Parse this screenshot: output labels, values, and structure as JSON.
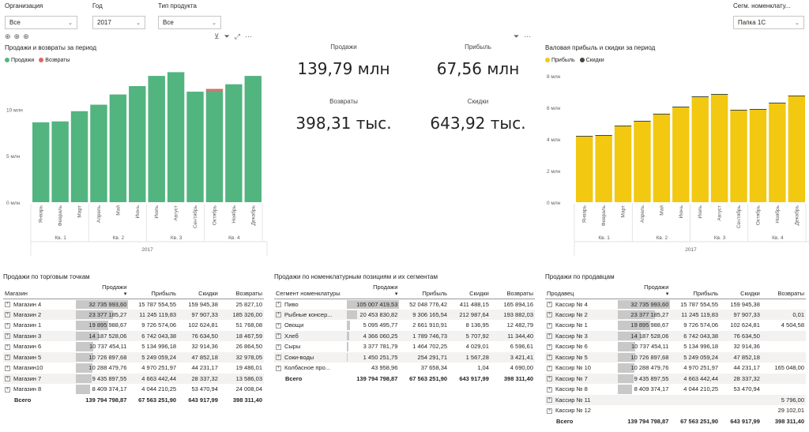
{
  "slicers": {
    "org": {
      "label": "Организация",
      "value": "Все"
    },
    "year": {
      "label": "Год",
      "value": "2017"
    },
    "ptype": {
      "label": "Тип продукта",
      "value": "Все"
    },
    "segm": {
      "label": "Сегм. номенклату...",
      "value": "Папка 1С"
    }
  },
  "icons": {
    "drill_up": "arrow-up-circle",
    "drill_down": "arrow-down-circle",
    "expand": "fork",
    "filter": "funnel",
    "focus": "expand-box",
    "more": "ellipsis"
  },
  "colors": {
    "sales": "#52b47f",
    "returns": "#e06666",
    "profit": "#f2c811",
    "discounts": "#3d4a3d"
  },
  "left_chart": {
    "title": "Продажи и возвраты за период",
    "legend": [
      "Продажи",
      "Возвраты"
    ],
    "chart_data": {
      "type": "bar",
      "categories": [
        "Январь",
        "Февраль",
        "Март",
        "Апрель",
        "Май",
        "Июнь",
        "Июль",
        "Август",
        "Сентябрь",
        "Октябрь",
        "Ноябрь",
        "Декабрь"
      ],
      "quarters": [
        "Кв. 1",
        "Кв. 2",
        "Кв. 3",
        "Кв. 4"
      ],
      "year": "2017",
      "series": [
        {
          "name": "Продажи",
          "values": [
            8.6,
            8.7,
            9.8,
            10.5,
            11.6,
            12.5,
            13.6,
            14.0,
            11.9,
            12.0,
            12.7,
            13.6
          ]
        },
        {
          "name": "Возвраты",
          "values": [
            0,
            0,
            0,
            0,
            0,
            0,
            0,
            0,
            0,
            0.2,
            0,
            0
          ]
        }
      ],
      "yticks": [
        "0 млн",
        "5 млн",
        "10 млн"
      ],
      "ylim": [
        0,
        14.8
      ]
    }
  },
  "kpis": [
    {
      "label": "Продажи",
      "value": "139,79 млн"
    },
    {
      "label": "Прибыль",
      "value": "67,56 млн"
    },
    {
      "label": "Возвраты",
      "value": "398,31 тыс."
    },
    {
      "label": "Скидки",
      "value": "643,92 тыс."
    }
  ],
  "right_chart": {
    "title": "Валовая прибыль и скидки за период",
    "legend": [
      "Прибыль",
      "Скидки"
    ],
    "chart_data": {
      "type": "bar",
      "categories": [
        "Январь",
        "Февраль",
        "Март",
        "Апрель",
        "Май",
        "Июнь",
        "Июль",
        "Август",
        "Сентябрь",
        "Октябрь",
        "Ноябрь",
        "Декабрь"
      ],
      "quarters": [
        "Кв. 1",
        "Кв. 2",
        "Кв. 3",
        "Кв. 4"
      ],
      "year": "2017",
      "series": [
        {
          "name": "Прибыль",
          "values": [
            4.15,
            4.2,
            4.8,
            5.1,
            5.55,
            6.0,
            6.65,
            6.8,
            5.8,
            5.85,
            6.25,
            6.7
          ]
        },
        {
          "name": "Скидки",
          "values": [
            0.05,
            0.05,
            0.05,
            0.05,
            0.05,
            0.05,
            0.05,
            0.05,
            0.05,
            0.05,
            0.05,
            0.05
          ]
        }
      ],
      "yticks": [
        "0 млн",
        "2 млн",
        "4 млн",
        "6 млн",
        "8 млн"
      ],
      "ylim": [
        0,
        8.4
      ]
    }
  },
  "table1": {
    "title": "Продажи по торговым точкам",
    "headers": [
      "Магазин",
      "Продажи",
      "Прибыль",
      "Скидки",
      "Возвраты"
    ],
    "rows": [
      {
        "name": "Магазин 4",
        "sales": "32 735 993,60",
        "profit": "15 787 554,55",
        "disc": "159 945,38",
        "ret": "25 827,10",
        "pct": 1.0
      },
      {
        "name": "Магазин 2",
        "sales": "23 377 185,27",
        "profit": "11 245 119,83",
        "disc": "97 907,33",
        "ret": "185 326,00",
        "pct": 0.71
      },
      {
        "name": "Магазин 1",
        "sales": "19 895 988,67",
        "profit": "9 726 574,06",
        "disc": "102 624,81",
        "ret": "51 768,08",
        "pct": 0.61
      },
      {
        "name": "Магазин 3",
        "sales": "14 187 528,06",
        "profit": "6 742 043,38",
        "disc": "76 634,50",
        "ret": "18 467,59",
        "pct": 0.43
      },
      {
        "name": "Магазин 6",
        "sales": "10 737 454,11",
        "profit": "5 134 996,18",
        "disc": "32 914,36",
        "ret": "26 864,50",
        "pct": 0.33
      },
      {
        "name": "Магазин 5",
        "sales": "10 726 897,68",
        "profit": "5 249 059,24",
        "disc": "47 852,18",
        "ret": "32 978,05",
        "pct": 0.33
      },
      {
        "name": "Магазин10",
        "sales": "10 288 479,76",
        "profit": "4 970 251,97",
        "disc": "44 231,17",
        "ret": "19 486,01",
        "pct": 0.31
      },
      {
        "name": "Магазин 7",
        "sales": "9 435 897,55",
        "profit": "4 663 442,44",
        "disc": "28 337,32",
        "ret": "13 586,03",
        "pct": 0.29
      },
      {
        "name": "Магазин 8",
        "sales": "8 409 374,17",
        "profit": "4 044 210,25",
        "disc": "53 470,94",
        "ret": "24 008,04",
        "pct": 0.26
      }
    ],
    "total": {
      "name": "Всего",
      "sales": "139 794 798,87",
      "profit": "67 563 251,90",
      "disc": "643 917,99",
      "ret": "398 311,40"
    }
  },
  "table2": {
    "title": "Продажи по номенклатурным позициям и их сегментам",
    "headers": [
      "Сегмент номенклатуры",
      "Продажи",
      "Прибыль",
      "Скидки",
      "Возвраты"
    ],
    "rows": [
      {
        "name": "Пиво",
        "sales": "105 007 419,53",
        "profit": "52 048 776,42",
        "disc": "411 488,15",
        "ret": "165 894,16",
        "pct": 1.0
      },
      {
        "name": "Рыбные консер...",
        "sales": "20 453 830,82",
        "profit": "9 306 165,54",
        "disc": "212 987,64",
        "ret": "193 882,03",
        "pct": 0.19
      },
      {
        "name": "Овощи",
        "sales": "5 095 495,77",
        "profit": "2 661 910,91",
        "disc": "8 136,95",
        "ret": "12 482,79",
        "pct": 0.05
      },
      {
        "name": "Хлеб",
        "sales": "4 366 060,25",
        "profit": "1 789 746,73",
        "disc": "5 707,92",
        "ret": "11 344,40",
        "pct": 0.04
      },
      {
        "name": "Сыры",
        "sales": "3 377 781,79",
        "profit": "1 464 702,25",
        "disc": "4 029,01",
        "ret": "6 596,61",
        "pct": 0.03
      },
      {
        "name": "Соки-воды",
        "sales": "1 450 251,75",
        "profit": "254 291,71",
        "disc": "1 567,28",
        "ret": "3 421,41",
        "pct": 0.01
      },
      {
        "name": "Колбасное про...",
        "sales": "43 958,96",
        "profit": "37 658,34",
        "disc": "1,04",
        "ret": "4 690,00",
        "pct": 0.0
      }
    ],
    "total": {
      "name": "Всего",
      "sales": "139 794 798,87",
      "profit": "67 563 251,90",
      "disc": "643 917,99",
      "ret": "398 311,40"
    }
  },
  "table3": {
    "title": "Продажи по продавцам",
    "headers": [
      "Продавец",
      "Продажи",
      "Прибыль",
      "Скидки",
      "Возвраты"
    ],
    "rows": [
      {
        "name": "Кассир № 4",
        "sales": "32 735 993,60",
        "profit": "15 787 554,55",
        "disc": "159 945,38",
        "ret": "",
        "pct": 1.0
      },
      {
        "name": "Кассир № 2",
        "sales": "23 377 185,27",
        "profit": "11 245 119,83",
        "disc": "97 907,33",
        "ret": "0,01",
        "pct": 0.71
      },
      {
        "name": "Кассир № 1",
        "sales": "19 895 988,67",
        "profit": "9 726 574,06",
        "disc": "102 624,81",
        "ret": "4 504,58",
        "pct": 0.61
      },
      {
        "name": "Кассир № 3",
        "sales": "14 187 528,06",
        "profit": "6 742 043,38",
        "disc": "76 634,50",
        "ret": "",
        "pct": 0.43
      },
      {
        "name": "Кассир № 6",
        "sales": "10 737 454,11",
        "profit": "5 134 996,18",
        "disc": "32 914,36",
        "ret": "",
        "pct": 0.33
      },
      {
        "name": "Кассир № 5",
        "sales": "10 726 897,68",
        "profit": "5 249 059,24",
        "disc": "47 852,18",
        "ret": "",
        "pct": 0.33
      },
      {
        "name": "Кассир № 10",
        "sales": "10 288 479,76",
        "profit": "4 970 251,97",
        "disc": "44 231,17",
        "ret": "165 048,00",
        "pct": 0.31
      },
      {
        "name": "Кассир № 7",
        "sales": "9 435 897,55",
        "profit": "4 663 442,44",
        "disc": "28 337,32",
        "ret": "",
        "pct": 0.29
      },
      {
        "name": "Кассир № 8",
        "sales": "8 409 374,17",
        "profit": "4 044 210,25",
        "disc": "53 470,94",
        "ret": "",
        "pct": 0.26
      },
      {
        "name": "Кассир № 11",
        "sales": "",
        "profit": "",
        "disc": "",
        "ret": "5 796,00",
        "pct": 0.0
      },
      {
        "name": "Кассир № 12",
        "sales": "",
        "profit": "",
        "disc": "",
        "ret": "29 102,01",
        "pct": 0.0
      }
    ],
    "total": {
      "name": "Всего",
      "sales": "139 794 798,87",
      "profit": "67 563 251,90",
      "disc": "643 917,99",
      "ret": "398 311,40"
    }
  }
}
